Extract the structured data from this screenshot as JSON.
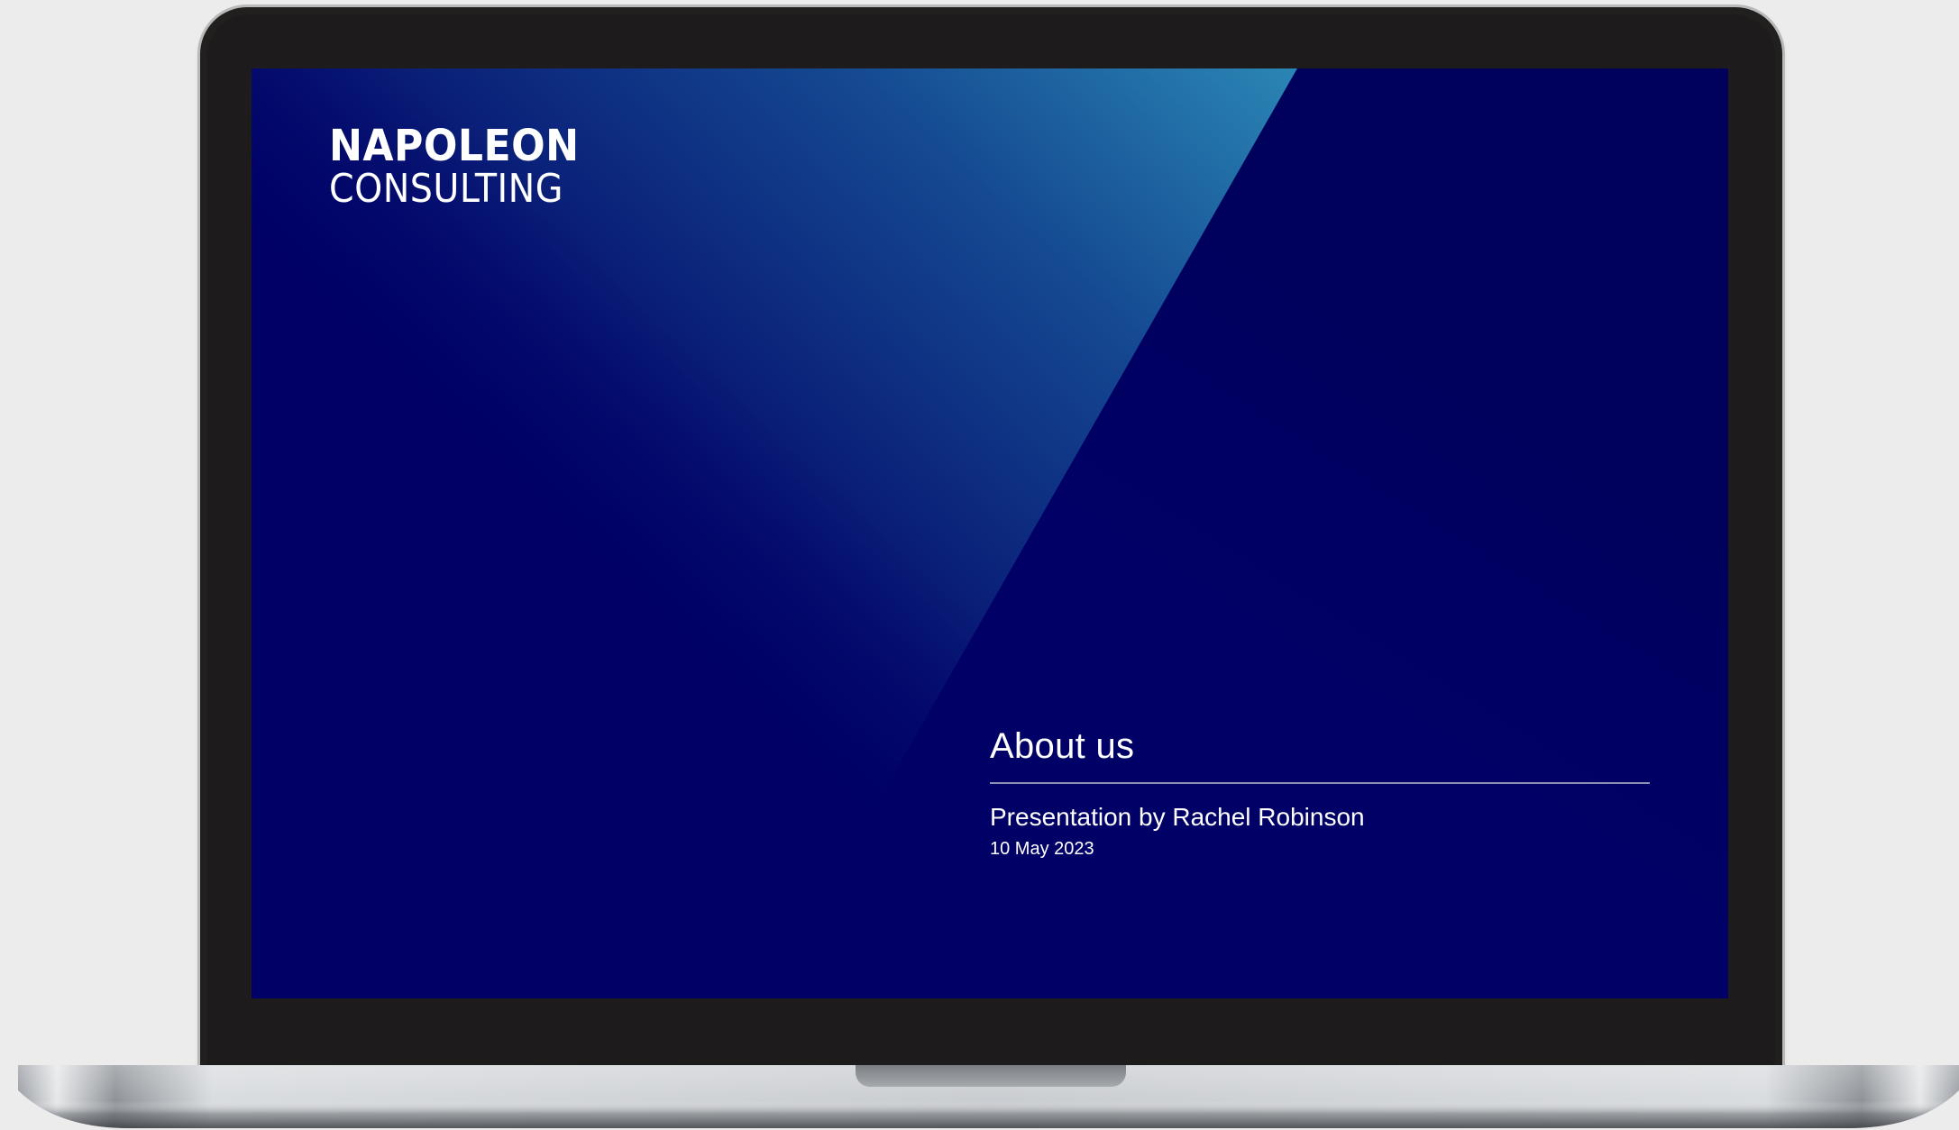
{
  "slide": {
    "logo_line1": "NAPOLEON",
    "logo_line2": "CONSULTING",
    "title": "About us",
    "subtitle": "Presentation by Rachel Robinson",
    "date": "10 May 2023"
  },
  "colors": {
    "background": "#ececec",
    "bezel": "#221f1f",
    "slide_navy": "#000066",
    "slide_accent": "#2aa0c8",
    "text": "#ffffff"
  }
}
